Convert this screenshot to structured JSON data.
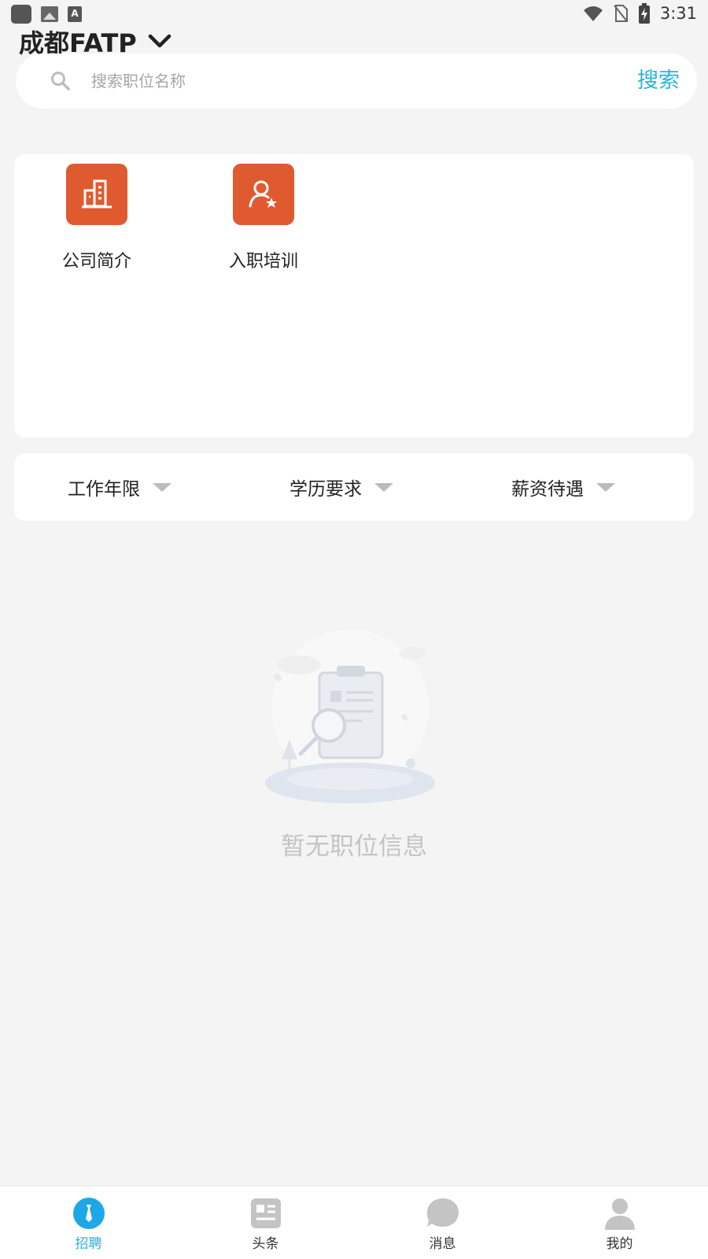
{
  "status_bar": {
    "time": "3:31",
    "notif_letter": "A"
  },
  "header": {
    "city": "成都FATP"
  },
  "search": {
    "placeholder": "搜索职位名称",
    "button_label": "搜索"
  },
  "quick_entries": [
    {
      "label": "公司简介",
      "icon": "building-icon"
    },
    {
      "label": "入职培训",
      "icon": "user-star-icon"
    }
  ],
  "filters": [
    {
      "label": "工作年限"
    },
    {
      "label": "学历要求"
    },
    {
      "label": "薪资待遇"
    }
  ],
  "empty_state": {
    "text": "暂无职位信息"
  },
  "bottom_nav": [
    {
      "label": "招聘",
      "icon": "tie-icon",
      "active": true
    },
    {
      "label": "头条",
      "icon": "news-icon",
      "active": false
    },
    {
      "label": "消息",
      "icon": "chat-bubble-icon",
      "active": false
    },
    {
      "label": "我的",
      "icon": "person-icon",
      "active": false
    }
  ],
  "colors": {
    "accent": "#2bb3d9",
    "entry_icon_bg": "#e05a30",
    "background": "#f4f4f4"
  }
}
